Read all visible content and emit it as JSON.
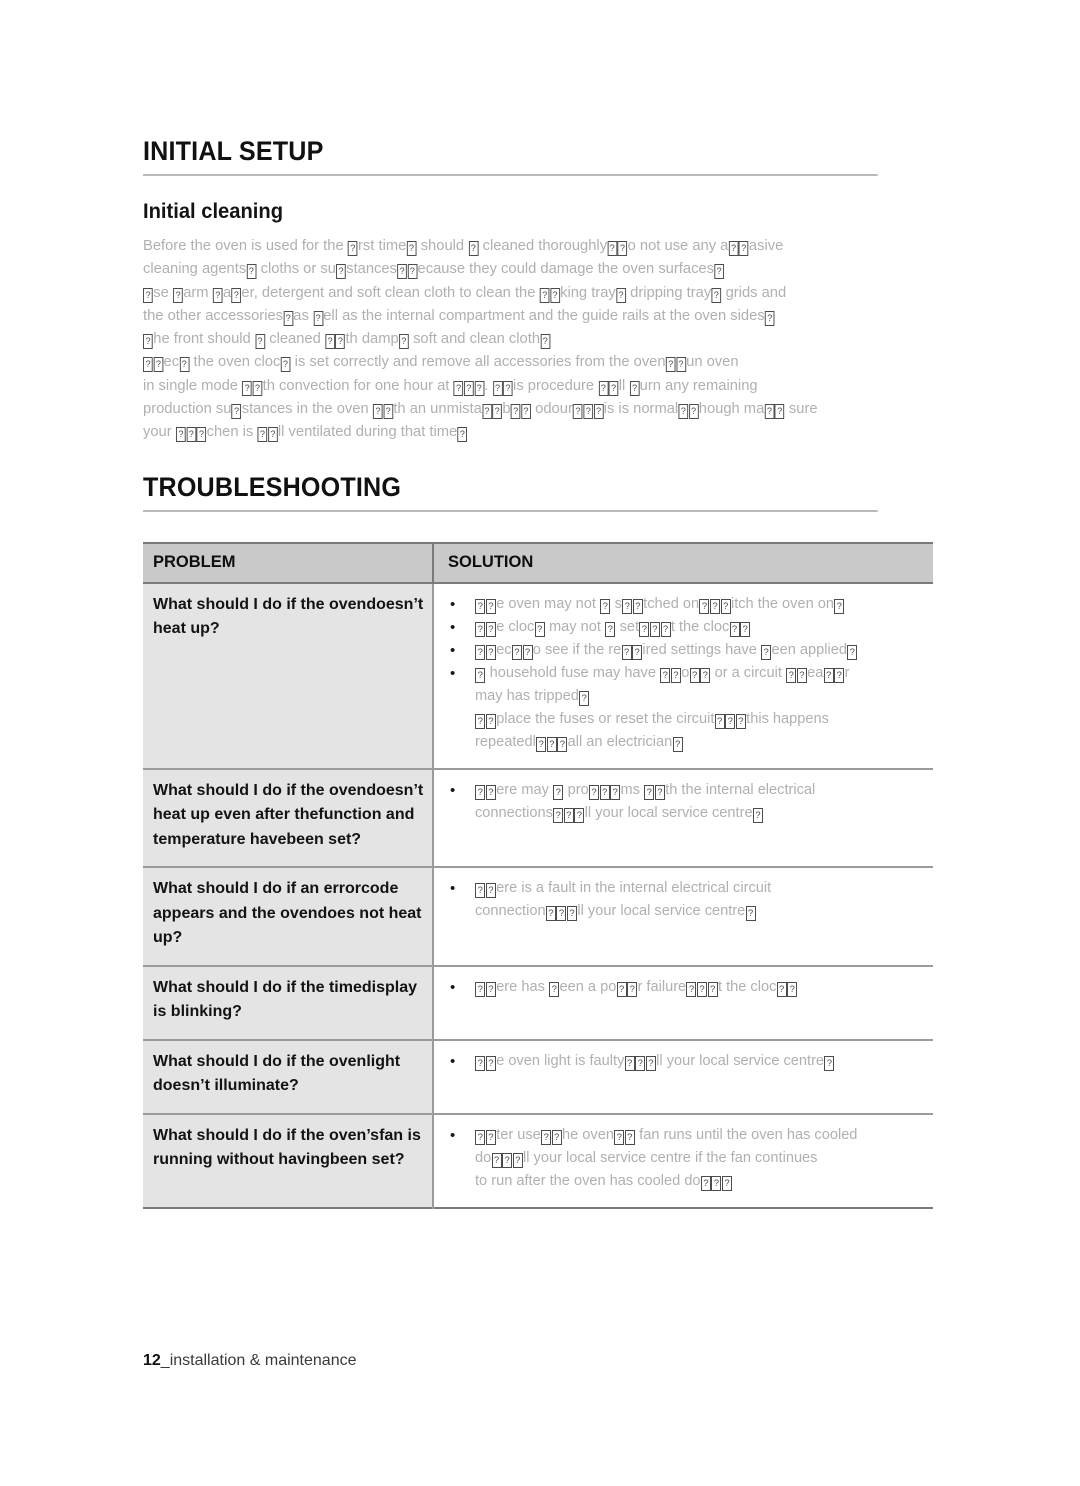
{
  "page": {
    "footer_page_number": "12",
    "footer_separator": "_",
    "footer_label": "installation & maintenance"
  },
  "colors": {
    "heading_text": "#111111",
    "body_text": "#b0b0b0",
    "table_header_bg": "#c9c9c9",
    "problem_cell_bg": "#e4e4e4",
    "solution_cell_bg": "#ffffff",
    "rule": "#b9b9b9",
    "table_border": "#7a7a7a",
    "tofu_box": "#4c4c4c"
  },
  "sections": {
    "initial_setup": {
      "title": "INITIAL SETUP",
      "subtitle": "Initial cleaning",
      "paragraph_lines": [
        "Before the oven is used for the [T]rst time[,] should [b] cleaned thoroughly[. D]o not use any a[br]asive",
        "cleaning agents[,] cloths or su[b]stances[, b]ecause they could damage the oven surfaces[.]",
        "[U]se [w]arm [w]a[t]er, detergent and soft clean cloth to clean the [ba]king tray[,] dripping tray[,] grids and",
        "the other accessories[, ]as [w]ell as the internal compartment and the guide rails at the oven sides[.]",
        "[T]he front should [b] cleaned [wi]th damp[,] soft and clean cloth[.]",
        "[Ch]ec[k] the oven cloc[k] is set correctly and remove all accessories from the oven[. R]un oven",
        "in single mode [wi]th convection for one hour at [250]. [Th]is procedure [wi]ll [b]urn any remaining",
        "production su[b]stances in the oven [wi]th an unmista[ka]b[le] odour[. Th]is is normal[, t]hough ma[ke] sure",
        "your [kit]chen is [we]ll ventilated during that time[.]"
      ]
    },
    "troubleshooting": {
      "title": "TROUBLESHOOTING",
      "table": {
        "headers": [
          "PROBLEM",
          "SOLUTION"
        ],
        "rows": [
          {
            "problem_lines": [
              "What should I do if the oven",
              "doesn’t heat up?"
            ],
            "solutions": [
              [
                "[Th]e oven may not [b] s[wi]tched on[. Sw]itch the oven on[.]"
              ],
              [
                "[Th]e cloc[k] may not [b] set[. Se]t the cloc[k.]"
              ],
              [
                "[Ch]ec[k t]o see if the re[qu]ired settings have [b]een applied[.]"
              ],
              [
                "[A] household fuse may have [bl]o[wn] or a circuit [br]ea[ke]r",
                "may has tripped[.]",
                "[Re]place the fuses or reset the circuit[. If ]this happens",
                "repeatedl[y, c]all an electrician[.]"
              ]
            ]
          },
          {
            "problem_lines": [
              "What should I do if the oven",
              "doesn’t heat up even after the",
              "function and temperature have",
              "been set?"
            ],
            "solutions": [
              [
                "[Th]ere may [b] pro[ble]ms [wi]th the internal electrical",
                "connections[. Ca]ll your local service centre[.]"
              ]
            ]
          },
          {
            "problem_lines": [
              "What should I do if an error",
              "code appears and the oven",
              "does not heat up?"
            ],
            "solutions": [
              [
                "[Th]ere is a fault in the internal electrical circuit",
                "connection[. Ca]ll your local service centre[.]"
              ]
            ]
          },
          {
            "problem_lines": [
              "What should I do if the time",
              "display is blinking?"
            ],
            "solutions": [
              [
                "[Th]ere has [b]een a po[we]r failure[. Se]t the cloc[k.]"
              ]
            ]
          },
          {
            "problem_lines": [
              "What should I do if the oven",
              "light doesn’t illuminate?"
            ],
            "solutions": [
              [
                "[Th]e oven light is faulty[. Ca]ll your local service centre[.]"
              ]
            ]
          },
          {
            "problem_lines": [
              "What should I do if the oven’s",
              "fan is running without having",
              "been set?"
            ],
            "solutions": [
              [
                "[Af]ter use[, t]he oven[’s] fan runs until the oven has cooled",
                "do[wn. Ca]ll your local service centre if the fan continues",
                "to run after the oven has cooled do[wn.]"
              ]
            ]
          }
        ]
      }
    }
  }
}
